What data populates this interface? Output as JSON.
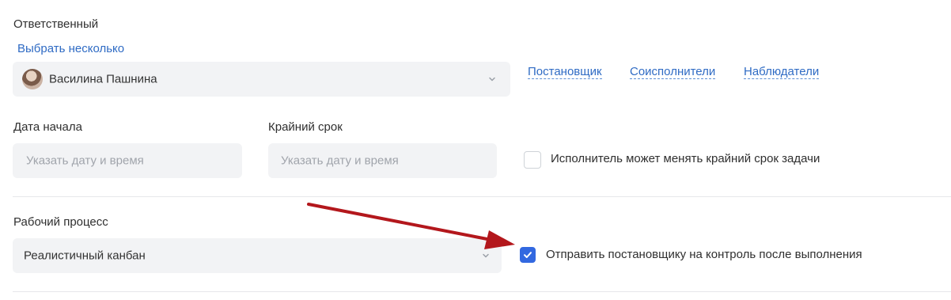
{
  "assignee": {
    "label": "Ответственный",
    "select_multiple": "Выбрать несколько",
    "value": "Василина Пашнина"
  },
  "roles": [
    "Постановщик",
    "Соисполнители",
    "Наблюдатели"
  ],
  "start_date": {
    "label": "Дата начала",
    "placeholder": "Указать дату и время"
  },
  "deadline": {
    "label": "Крайний срок",
    "placeholder": "Указать дату и время"
  },
  "can_change_deadline": {
    "label": "Исполнитель может менять крайний срок задачи",
    "checked": false
  },
  "workflow": {
    "label": "Рабочий процесс",
    "value": "Реалистичный канбан"
  },
  "send_to_control": {
    "label": "Отправить постановщику на контроль после выполнения",
    "checked": true
  },
  "colors": {
    "accent": "#3268e0",
    "link": "#2f6bc4",
    "field_bg": "#f2f3f5",
    "arrow": "#b3171c"
  }
}
